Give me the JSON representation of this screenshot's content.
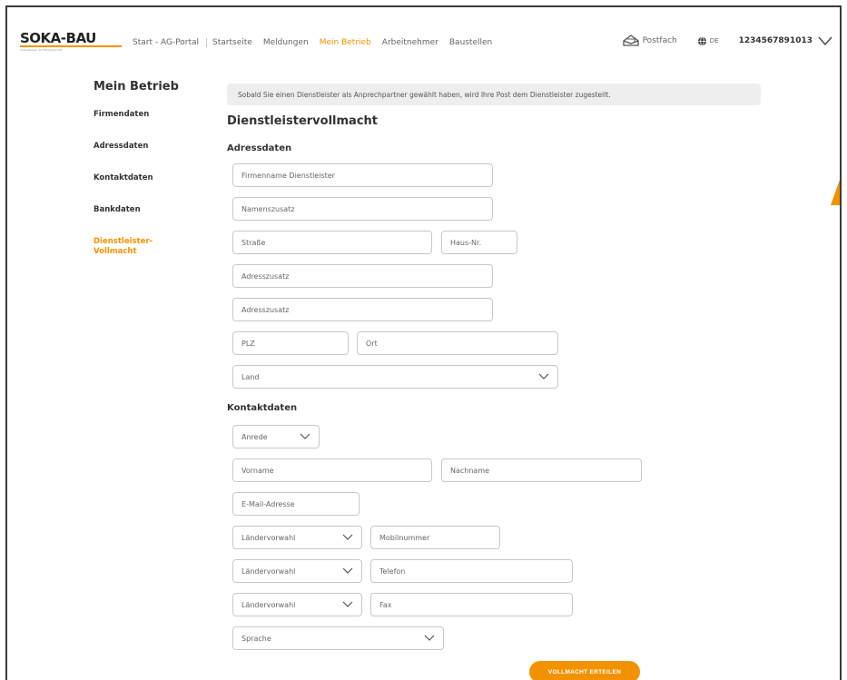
{
  "brand": {
    "name": "SOKA-BAU",
    "tagline": "Sozialkassen der Bauwirtschaft",
    "accent": "#f39200"
  },
  "nav": {
    "items": [
      {
        "label": "Start - AG-Portal",
        "active": false
      },
      {
        "label": "Startseite",
        "active": false
      },
      {
        "label": "Meldungen",
        "active": false
      },
      {
        "label": "Mein Betrieb",
        "active": true
      },
      {
        "label": "Arbeitnehmer",
        "active": false
      },
      {
        "label": "Baustellen",
        "active": false
      }
    ],
    "postfach_label": "Postfach",
    "postfach_icon": "mail-icon",
    "language_label": "DE",
    "language_icon": "globe-icon",
    "account_number": "1234567891013",
    "account_icon": "chevron-down-icon"
  },
  "sidebar": {
    "title": "Mein Betrieb",
    "items": [
      {
        "label": "Firmendaten",
        "active": false
      },
      {
        "label": "Adressdaten",
        "active": false
      },
      {
        "label": "Kontaktdaten",
        "active": false
      },
      {
        "label": "Bankdaten",
        "active": false
      },
      {
        "label": "Dienstleister-\nVollmacht",
        "active": true
      }
    ]
  },
  "main": {
    "info_text": "Sobald Sie einen Dienstleister als Anprechpartner gewählt haben, wird Ihre Post dem Dienstleister zugestellt.",
    "title": "Dienstleistervollmacht",
    "address_section": {
      "title": "Adressdaten",
      "firmenname": "Firmenname Dienstleister",
      "namenszusatz": "Namenszusatz",
      "strasse": "Straße",
      "hausnr": "Haus-Nr.",
      "adresszusatz1": "Adresszusatz",
      "adresszusatz2": "Adresszusatz",
      "plz": "PLZ",
      "ort": "Ort",
      "land": "Land"
    },
    "contact_section": {
      "title": "Kontaktdaten",
      "anrede": "Anrede",
      "vorname": "Vorname",
      "nachname": "Nachname",
      "email": "E-Mail-Adresse",
      "laendervorwahl_mobil": "Ländervorwahl",
      "mobilnummer": "Mobilnummer",
      "laendervorwahl_telefon": "Ländervorwahl",
      "telefon": "Telefon",
      "laendervorwahl_fax": "Ländervorwahl",
      "fax": "Fax",
      "sprache": "Sprache"
    },
    "submit_label": "VOLLMACHT ERTEILEN"
  }
}
